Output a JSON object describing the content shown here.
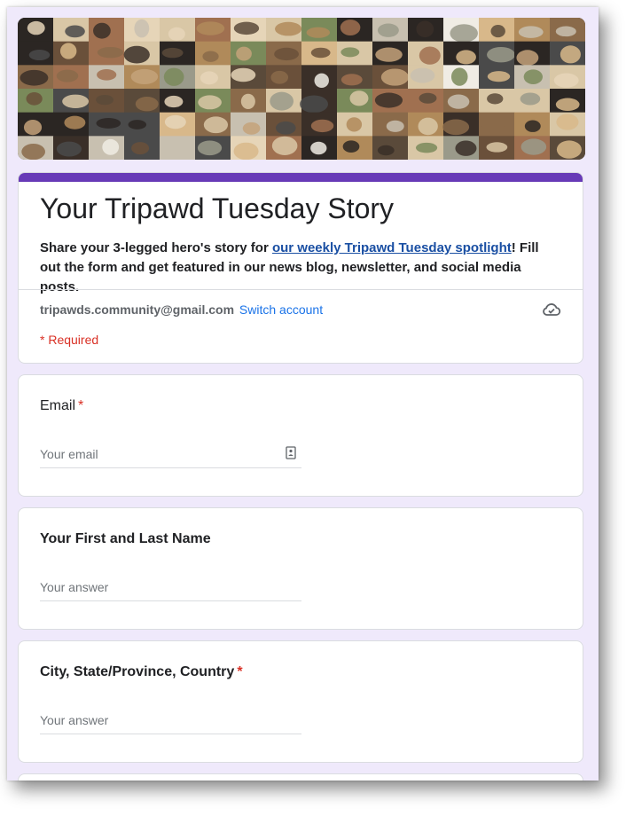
{
  "banner": {
    "image_name": "dog-collage-banner",
    "palette": [
      "#8a6a4a",
      "#d9c7a6",
      "#3a2f28",
      "#b08a5a",
      "#f0ece4",
      "#5a4a3a",
      "#c4a27a",
      "#2b2623",
      "#e6d5b8",
      "#7a8a5a",
      "#a07050",
      "#d8b88a",
      "#4a4a4a",
      "#9a9a8a",
      "#6a503a",
      "#c8c0b0"
    ]
  },
  "header": {
    "accent_color": "#673ab7",
    "title": "Your Tripawd Tuesday Story",
    "description_prefix": "Share your 3-legged hero's story for ",
    "description_link": "our weekly Tripawd Tuesday spotlight",
    "description_suffix": "! Fill out the form and get featured in our news blog, newsletter, and social media posts.",
    "account_email": "tripawds.community@gmail.com",
    "switch_account": "Switch account",
    "cloud_icon": "cloud-saved-icon",
    "required_note": "* Required"
  },
  "questions": [
    {
      "label": "Email",
      "required_mark": "*",
      "placeholder": "Your email",
      "icon": "contact-card-icon"
    },
    {
      "label": "Your First and Last Name",
      "required_mark": "",
      "placeholder": "Your answer"
    },
    {
      "label": "City, State/Province, Country",
      "required_mark": "*",
      "placeholder": "Your answer"
    }
  ],
  "colors": {
    "background": "#efe9fb",
    "required": "#d93025",
    "link": "#1a73e8"
  }
}
